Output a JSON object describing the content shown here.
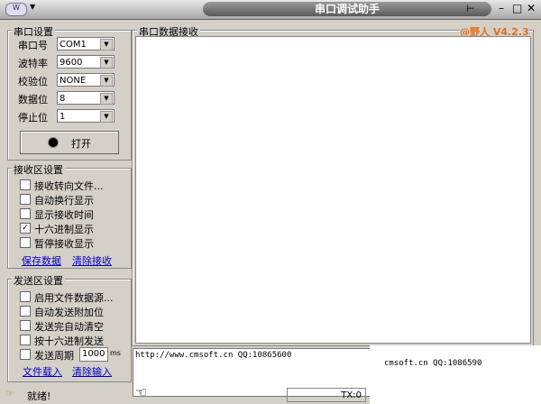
{
  "window": {
    "title": "串口调试助手",
    "version": "@野人 V4.2.3"
  },
  "serial": {
    "title": "串口设置",
    "rows": [
      {
        "label": "串口号",
        "value": "COM1"
      },
      {
        "label": "波特率",
        "value": "9600"
      },
      {
        "label": "校验位",
        "value": "NONE"
      },
      {
        "label": "数据位",
        "value": "8"
      },
      {
        "label": "停止位",
        "value": "1"
      }
    ],
    "open_label": "打开"
  },
  "receive": {
    "title": "接收区设置",
    "items": [
      {
        "label": "接收转向文件...",
        "checked": false
      },
      {
        "label": "自动换行显示",
        "checked": false
      },
      {
        "label": "显示接收时间",
        "checked": false
      },
      {
        "label": "十六进制显示",
        "checked": true
      },
      {
        "label": "暂停接收显示",
        "checked": false
      }
    ],
    "save_link": "保存数据",
    "clear_link": "清除接收"
  },
  "send": {
    "title": "发送区设置",
    "items": [
      {
        "label": "启用文件数据源...",
        "checked": false
      },
      {
        "label": "自动发送附加位",
        "checked": false
      },
      {
        "label": "发送完自动清空",
        "checked": false
      },
      {
        "label": "按十六进制发送",
        "checked": false
      }
    ],
    "period_label": "发送周期",
    "period_value": "1000",
    "period_unit": "ms",
    "load_link": "文件载入",
    "clear_link": "清除输入"
  },
  "main": {
    "receive_title": "串口数据接收",
    "send_text": "http://www.cmsoft.cn QQ:10865600",
    "overlay_text": "cmsoft.cn QQ:1086590"
  },
  "status": {
    "text": "就绪!",
    "tx": "TX:0"
  }
}
